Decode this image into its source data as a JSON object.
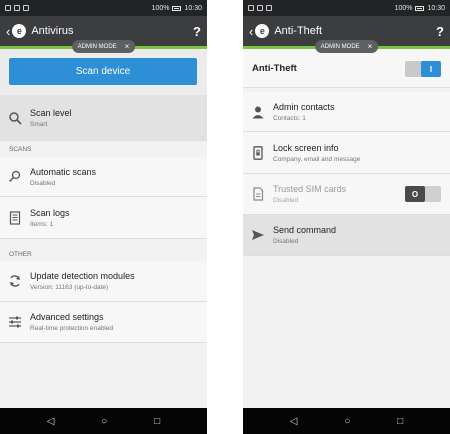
{
  "status_bar": {
    "battery": "100%",
    "time": "10:30"
  },
  "admin_chip": {
    "label": "ADMIN MODE",
    "close": "×"
  },
  "antivirus": {
    "title": "Antivirus",
    "help": "?",
    "scan_button": "Scan device",
    "scan_level": {
      "title": "Scan level",
      "subtitle": "Smart",
      "icon": "magnifier-icon"
    },
    "section_scans": "SCANS",
    "automatic_scans": {
      "title": "Automatic scans",
      "subtitle": "Disabled",
      "icon": "scan-schedule-icon"
    },
    "scan_logs": {
      "title": "Scan logs",
      "subtitle": "Items: 1",
      "icon": "log-document-icon"
    },
    "section_other": "OTHER",
    "update_modules": {
      "title": "Update detection modules",
      "subtitle": "Version: 11163 (up-to-date)",
      "icon": "refresh-icon"
    },
    "advanced_settings": {
      "title": "Advanced settings",
      "subtitle": "Real-time protection enabled",
      "icon": "sliders-icon"
    }
  },
  "antitheft": {
    "title": "Anti-Theft",
    "help": "?",
    "header_label": "Anti-Theft",
    "header_toggle": "I",
    "admin_contacts": {
      "title": "Admin contacts",
      "subtitle": "Contacts: 1",
      "icon": "person-icon"
    },
    "lock_screen": {
      "title": "Lock screen info",
      "subtitle": "Company, email and message",
      "icon": "phone-lock-icon"
    },
    "trusted_sim": {
      "title": "Trusted SIM cards",
      "subtitle": "Disabled",
      "icon": "sim-card-icon",
      "toggle": "O"
    },
    "send_command": {
      "title": "Send command",
      "subtitle": "Disabled",
      "icon": "send-icon"
    }
  },
  "colors": {
    "accent": "#2d8fd5",
    "green": "#7cc242",
    "appbar": "#3c3d3f"
  }
}
